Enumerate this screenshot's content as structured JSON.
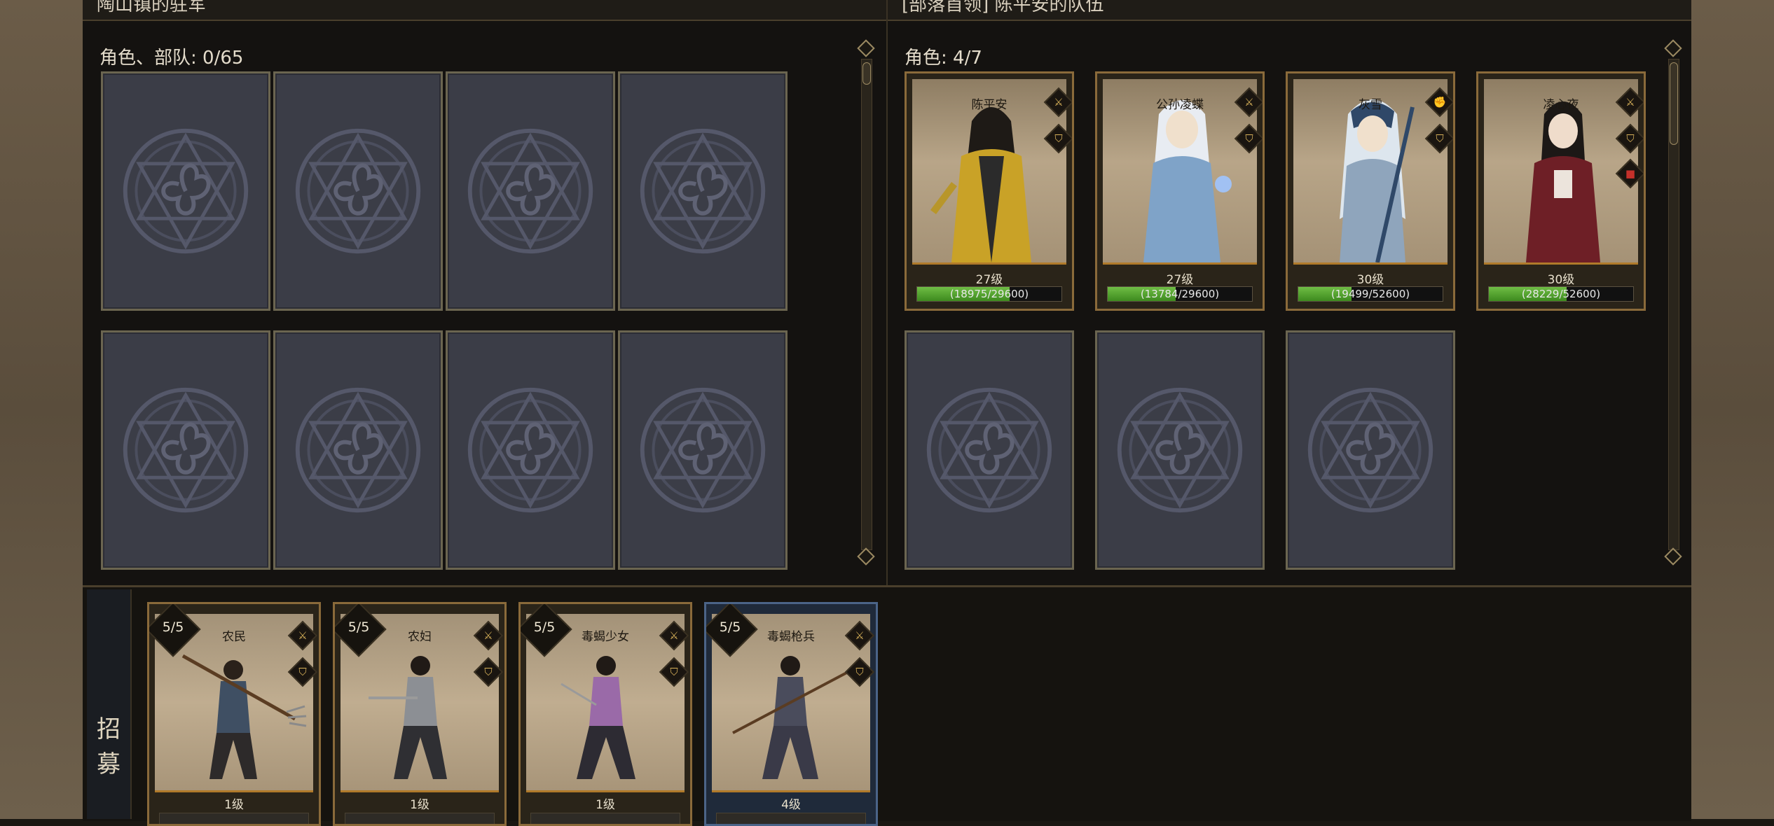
{
  "left_panel": {
    "title": "陶山镇的驻军",
    "count_label": "角色、部队: 0/65"
  },
  "right_panel": {
    "title": "[部落首领] 陈平安的队伍",
    "count_label": "角色: 4/7",
    "characters": [
      {
        "name": "陈平安",
        "level": "27级",
        "hp": "(18975/29600)",
        "hp_ratio": 0.64
      },
      {
        "name": "公孙凌蝶",
        "level": "27级",
        "hp": "(13784/29600)",
        "hp_ratio": 0.47
      },
      {
        "name": "灰雪",
        "level": "30级",
        "hp": "(19499/52600)",
        "hp_ratio": 0.37
      },
      {
        "name": "凌心夜",
        "level": "30级",
        "hp": "(28229/52600)",
        "hp_ratio": 0.54
      }
    ]
  },
  "recruit": {
    "tab_chars": [
      "招",
      "募"
    ],
    "units": [
      {
        "name": "农民",
        "stock": "5/5",
        "level": "1级"
      },
      {
        "name": "农妇",
        "stock": "5/5",
        "level": "1级"
      },
      {
        "name": "毒蝎少女",
        "stock": "5/5",
        "level": "1级"
      },
      {
        "name": "毒蝎枪兵",
        "stock": "5/5",
        "level": "4级"
      }
    ]
  },
  "colors": {
    "accent_gold": "#b07a2a",
    "hp_green": "#5aa834",
    "slot_gray": "#3b3d47"
  },
  "icons": [
    "sword-icon",
    "shield-icon",
    "fist-icon",
    "red-square-icon",
    "scroll-arrow-icon"
  ]
}
